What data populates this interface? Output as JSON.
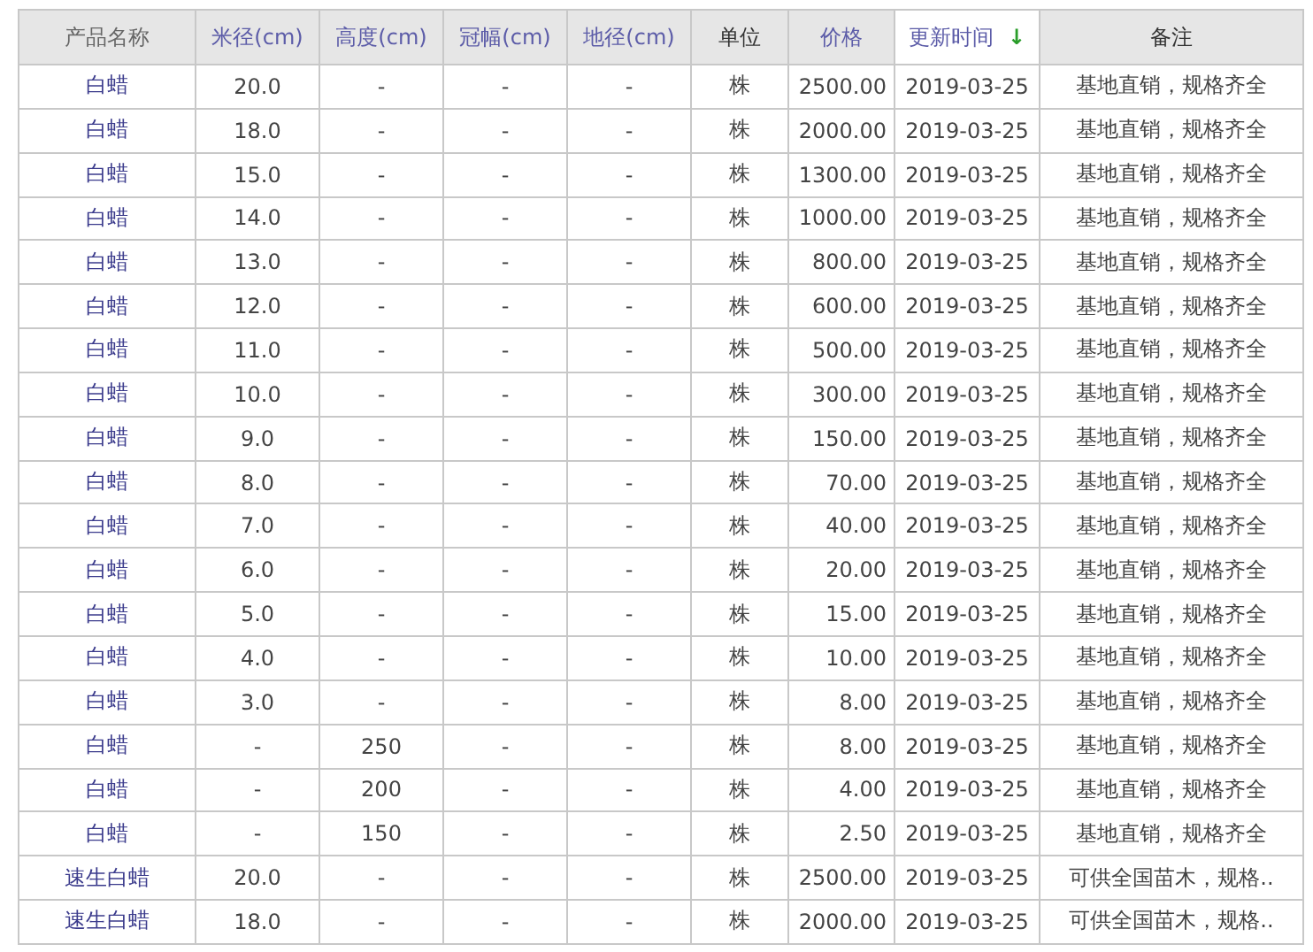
{
  "table": {
    "columns": [
      {
        "label": "产品名称",
        "kind": "plain",
        "selected": false
      },
      {
        "label": "米径(cm)",
        "kind": "sortable",
        "selected": false
      },
      {
        "label": "高度(cm)",
        "kind": "sortable",
        "selected": false
      },
      {
        "label": "冠幅(cm)",
        "kind": "sortable",
        "selected": false
      },
      {
        "label": "地径(cm)",
        "kind": "sortable",
        "selected": false
      },
      {
        "label": "单位",
        "kind": "fixed",
        "selected": false
      },
      {
        "label": "价格",
        "kind": "sortable",
        "selected": false
      },
      {
        "label": "更新时间",
        "kind": "sortable",
        "selected": true,
        "sort_arrow": "↓"
      },
      {
        "label": "备注",
        "kind": "fixed",
        "selected": false
      }
    ],
    "rows": [
      [
        "白蜡",
        "20.0",
        "-",
        "-",
        "-",
        "株",
        "2500.00",
        "2019-03-25",
        "基地直销，规格齐全"
      ],
      [
        "白蜡",
        "18.0",
        "-",
        "-",
        "-",
        "株",
        "2000.00",
        "2019-03-25",
        "基地直销，规格齐全"
      ],
      [
        "白蜡",
        "15.0",
        "-",
        "-",
        "-",
        "株",
        "1300.00",
        "2019-03-25",
        "基地直销，规格齐全"
      ],
      [
        "白蜡",
        "14.0",
        "-",
        "-",
        "-",
        "株",
        "1000.00",
        "2019-03-25",
        "基地直销，规格齐全"
      ],
      [
        "白蜡",
        "13.0",
        "-",
        "-",
        "-",
        "株",
        "800.00",
        "2019-03-25",
        "基地直销，规格齐全"
      ],
      [
        "白蜡",
        "12.0",
        "-",
        "-",
        "-",
        "株",
        "600.00",
        "2019-03-25",
        "基地直销，规格齐全"
      ],
      [
        "白蜡",
        "11.0",
        "-",
        "-",
        "-",
        "株",
        "500.00",
        "2019-03-25",
        "基地直销，规格齐全"
      ],
      [
        "白蜡",
        "10.0",
        "-",
        "-",
        "-",
        "株",
        "300.00",
        "2019-03-25",
        "基地直销，规格齐全"
      ],
      [
        "白蜡",
        "9.0",
        "-",
        "-",
        "-",
        "株",
        "150.00",
        "2019-03-25",
        "基地直销，规格齐全"
      ],
      [
        "白蜡",
        "8.0",
        "-",
        "-",
        "-",
        "株",
        "70.00",
        "2019-03-25",
        "基地直销，规格齐全"
      ],
      [
        "白蜡",
        "7.0",
        "-",
        "-",
        "-",
        "株",
        "40.00",
        "2019-03-25",
        "基地直销，规格齐全"
      ],
      [
        "白蜡",
        "6.0",
        "-",
        "-",
        "-",
        "株",
        "20.00",
        "2019-03-25",
        "基地直销，规格齐全"
      ],
      [
        "白蜡",
        "5.0",
        "-",
        "-",
        "-",
        "株",
        "15.00",
        "2019-03-25",
        "基地直销，规格齐全"
      ],
      [
        "白蜡",
        "4.0",
        "-",
        "-",
        "-",
        "株",
        "10.00",
        "2019-03-25",
        "基地直销，规格齐全"
      ],
      [
        "白蜡",
        "3.0",
        "-",
        "-",
        "-",
        "株",
        "8.00",
        "2019-03-25",
        "基地直销，规格齐全"
      ],
      [
        "白蜡",
        "-",
        "250",
        "-",
        "-",
        "株",
        "8.00",
        "2019-03-25",
        "基地直销，规格齐全"
      ],
      [
        "白蜡",
        "-",
        "200",
        "-",
        "-",
        "株",
        "4.00",
        "2019-03-25",
        "基地直销，规格齐全"
      ],
      [
        "白蜡",
        "-",
        "150",
        "-",
        "-",
        "株",
        "2.50",
        "2019-03-25",
        "基地直销，规格齐全"
      ],
      [
        "速生白蜡",
        "20.0",
        "-",
        "-",
        "-",
        "株",
        "2500.00",
        "2019-03-25",
        "可供全国苗木，规格.."
      ],
      [
        "速生白蜡",
        "18.0",
        "-",
        "-",
        "-",
        "株",
        "2000.00",
        "2019-03-25",
        "可供全国苗木，规格.."
      ]
    ]
  }
}
